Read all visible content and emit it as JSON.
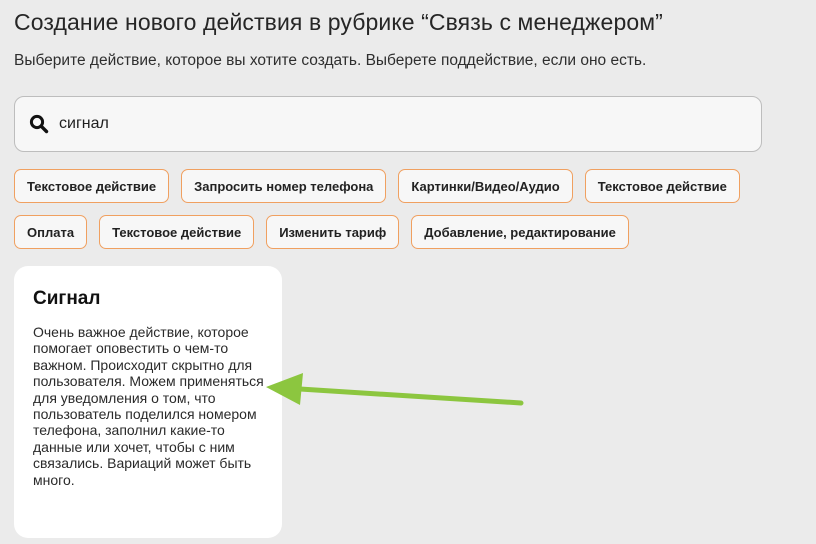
{
  "header": {
    "title": "Создание нового действия в рубрике “Связь с менеджером”",
    "subtitle": "Выберите действие, которое вы хотите создать. Выберете поддействие, если оно есть."
  },
  "search": {
    "value": "сигнал",
    "icon": "search-icon"
  },
  "chips": {
    "row1": [
      "Текстовое действие",
      "Запросить номер телефона",
      "Картинки/Видео/Аудио",
      "Текстовое действие"
    ],
    "row2": [
      "Оплата",
      "Текстовое действие",
      "Изменить тариф",
      "Добавление, редактирование"
    ]
  },
  "card": {
    "title": "Сигнал",
    "description": "Очень важное действие, которое помогает оповестить о чем-то важном. Происходит скрытно для пользователя. Можем применяться для уведомления о том, что пользователь поделился номером телефона, заполнил какие-то данные или хочет, чтобы с ним связались. Вариаций может быть много."
  },
  "colors": {
    "background": "#ebebeb",
    "chip_border": "#f0a060",
    "arrow": "#8cc63f",
    "card_bg": "#ffffff"
  }
}
